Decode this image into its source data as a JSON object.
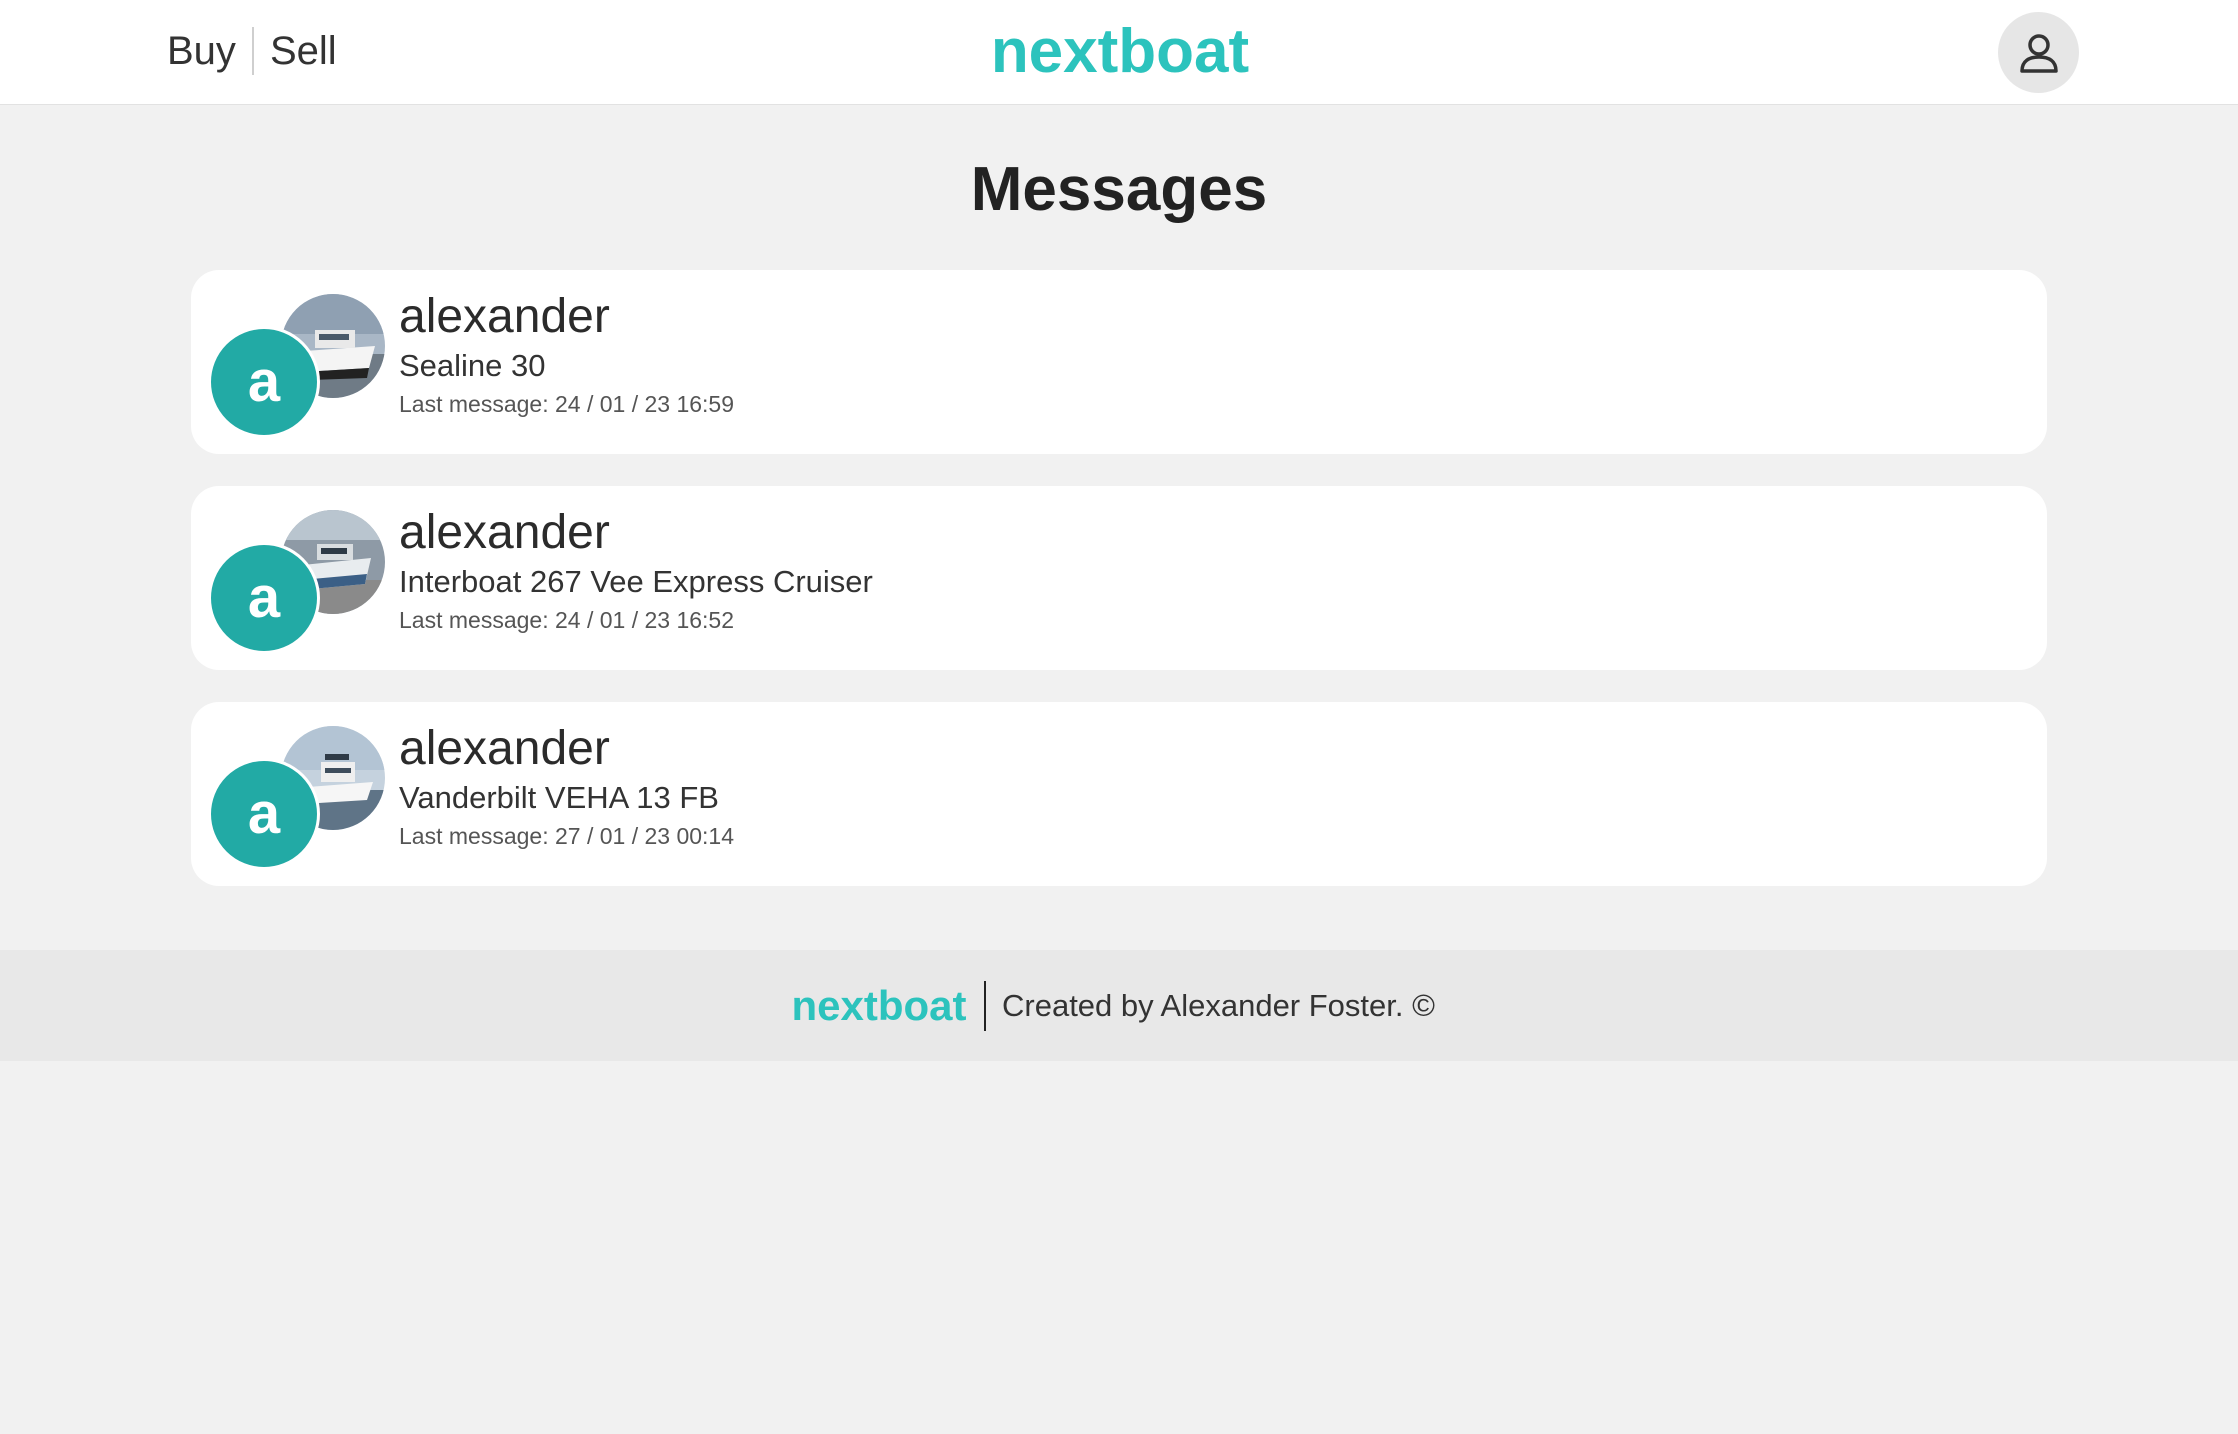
{
  "header": {
    "nav": [
      {
        "label": "Buy"
      },
      {
        "label": "Sell"
      }
    ],
    "logo_text": "nextboat",
    "profile_icon": "user-icon"
  },
  "page": {
    "title": "Messages"
  },
  "conversations": [
    {
      "user_name": "alexander",
      "avatar_letter": "a",
      "boat": "Sealine 30",
      "last_message": "Last message: 24 / 01 / 23 16:59"
    },
    {
      "user_name": "alexander",
      "avatar_letter": "a",
      "boat": "Interboat 267 Vee Express Cruiser",
      "last_message": "Last message: 24 / 01 / 23 16:52"
    },
    {
      "user_name": "alexander",
      "avatar_letter": "a",
      "boat": "Vanderbilt VEHA 13 FB",
      "last_message": "Last message: 27 / 01 / 23 00:14"
    }
  ],
  "footer": {
    "logo_text": "nextboat",
    "credit": "Created by Alexander Foster. ©"
  },
  "colors": {
    "brand": "#2cc3bd",
    "avatar": "#22aaa5",
    "background": "#f1f1f1"
  }
}
